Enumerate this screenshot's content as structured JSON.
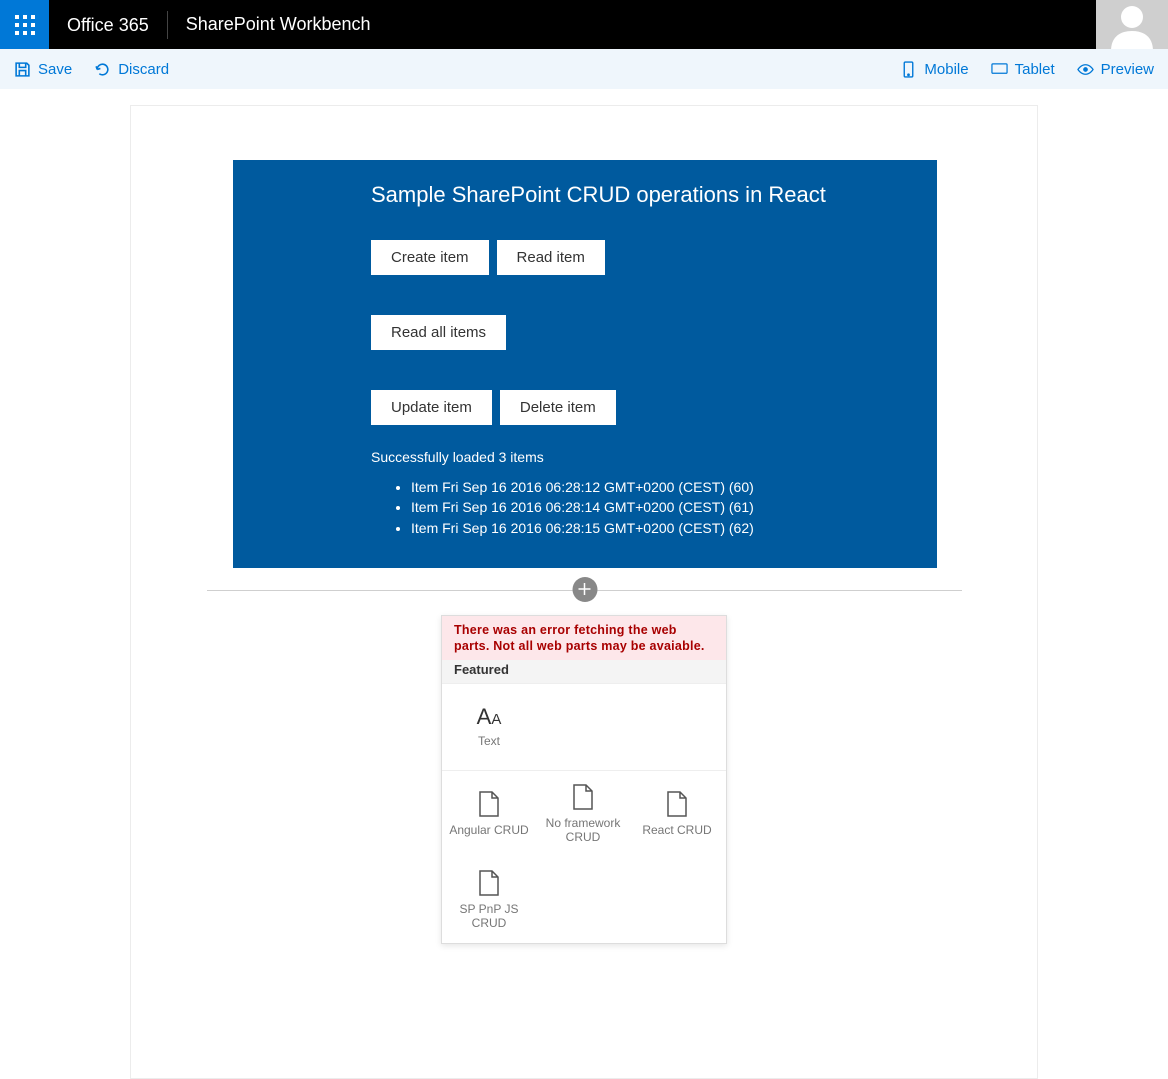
{
  "header": {
    "brand": "Office 365",
    "app_title": "SharePoint Workbench"
  },
  "toolbar": {
    "save": "Save",
    "discard": "Discard",
    "mobile": "Mobile",
    "tablet": "Tablet",
    "preview": "Preview"
  },
  "webpart": {
    "title": "Sample SharePoint CRUD operations in React",
    "buttons": {
      "create": "Create item",
      "read": "Read item",
      "read_all": "Read all items",
      "update": "Update item",
      "delete": "Delete item"
    },
    "status": "Successfully loaded 3 items",
    "items": [
      "Item Fri Sep 16 2016 06:28:12 GMT+0200 (CEST) (60)",
      "Item Fri Sep 16 2016 06:28:14 GMT+0200 (CEST) (61)",
      "Item Fri Sep 16 2016 06:28:15 GMT+0200 (CEST) (62)"
    ]
  },
  "picker": {
    "error": "There was an error fetching the web parts. Not all web parts may be avaiable.",
    "heading": "Featured",
    "text_label": "Text",
    "items": [
      {
        "label": "Angular CRUD"
      },
      {
        "label": "No framework CRUD"
      },
      {
        "label": "React CRUD"
      },
      {
        "label": "SP PnP JS CRUD"
      }
    ]
  }
}
